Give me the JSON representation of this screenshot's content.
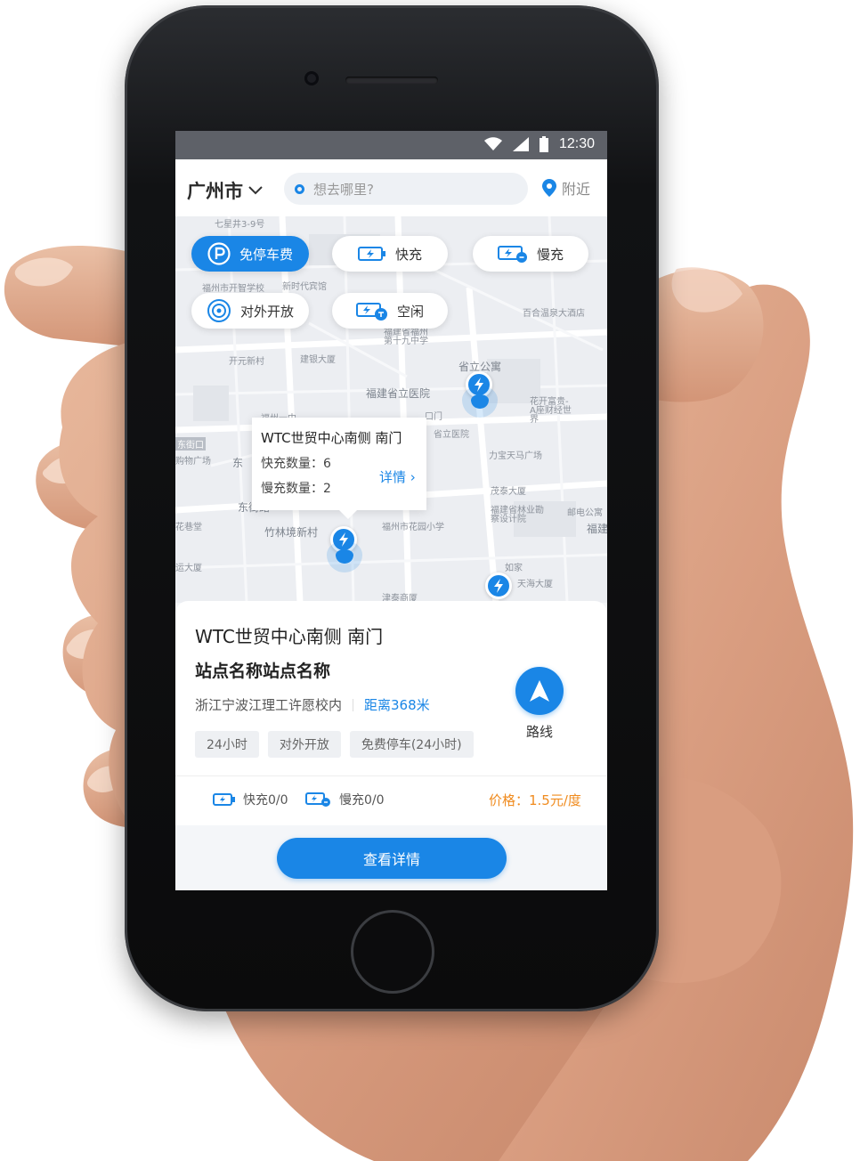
{
  "status_bar": {
    "time": "12:30"
  },
  "top_bar": {
    "city": "广州市",
    "search_placeholder": "想去哪里?",
    "nearby": "附近"
  },
  "filters": [
    {
      "label": "免停车费",
      "icon": "parking-icon",
      "active": true
    },
    {
      "label": "快充",
      "icon": "fast-charge-icon",
      "active": false
    },
    {
      "label": "慢充",
      "icon": "slow-charge-icon",
      "active": false
    },
    {
      "label": "对外开放",
      "icon": "open-public-icon",
      "active": false
    },
    {
      "label": "空闲",
      "icon": "idle-charger-icon",
      "active": false
    }
  ],
  "map_labels": {
    "province_hospital": "福建省立医院",
    "apartment": "省立公寓",
    "village": "竹林境新村",
    "dongjie": "东街口",
    "dong": "东",
    "road": "路",
    "fujian": "福建",
    "dong_road": "东街路",
    "l1": "七星井3-9号",
    "l2": "福州市开智学校",
    "l3": "新时代宾馆",
    "l4": "福建省福州第十九中学",
    "l5": "百合温泉大酒店",
    "l6": "开元新村",
    "l7": "建银大厦",
    "l8": "福州一中",
    "l9": "口门",
    "l10": "花开富贵-A座财经世界",
    "l11": "力宝天马广场",
    "l12": "茂泰大厦",
    "l13": "福建省林业勘察设计院",
    "l14": "邮电公寓",
    "l15": "福州市花园小学",
    "l16": "如家",
    "l17": "津泰商厦",
    "l18": "天海大厦",
    "l19": "省立医院",
    "l20": "购物广场",
    "l21": "花巷堂",
    "l22": "运大厦"
  },
  "popup": {
    "title": "WTC世贸中心南侧 南门",
    "fast_count": "快充数量：6",
    "slow_count": "慢充数量：2",
    "detail_link": "详情"
  },
  "station_card": {
    "name": "WTC世贸中心南侧 南门",
    "subtitle": "站点名称站点名称",
    "address": "浙江宁波江理工许愿校内",
    "distance": "距离368米",
    "tags": [
      "24小时",
      "对外开放",
      "免费停车(24小时)"
    ],
    "route_label": "路线",
    "fast_stat": "快充0/0",
    "slow_stat": "慢充0/0",
    "price": "价格：1.5元/度",
    "details_button": "查看详情"
  },
  "colors": {
    "accent": "#1a86e6",
    "price": "#f08b1e",
    "status_bar": "#5e6168"
  }
}
